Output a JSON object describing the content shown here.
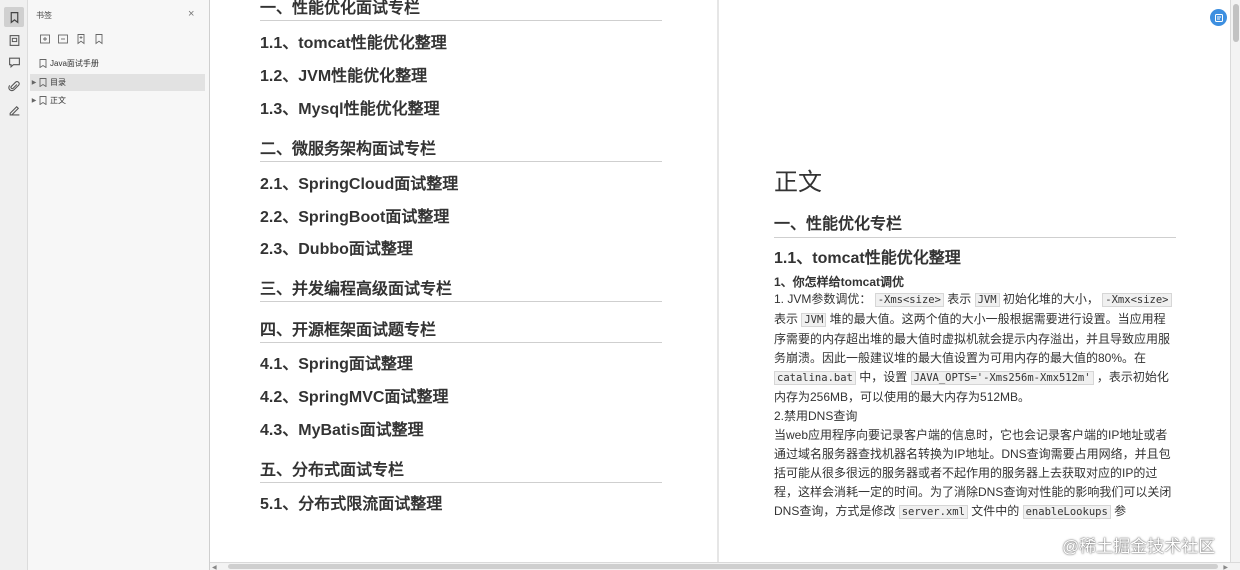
{
  "sidebar": {
    "title": "书签",
    "close_label": "×",
    "bookmarks": [
      {
        "label": "Java面试手册",
        "expandable": false
      },
      {
        "label": "目录",
        "expandable": true,
        "highlighted": true
      },
      {
        "label": "正文",
        "expandable": true
      }
    ]
  },
  "left_page": {
    "items": [
      {
        "level": 1,
        "text": "一、性能优化面试专栏"
      },
      {
        "level": 2,
        "text": "1.1、tomcat性能优化整理"
      },
      {
        "level": 2,
        "text": "1.2、JVM性能优化整理"
      },
      {
        "level": 2,
        "text": "1.3、Mysql性能优化整理"
      },
      {
        "level": 1,
        "text": "二、微服务架构面试专栏"
      },
      {
        "level": 2,
        "text": "2.1、SpringCloud面试整理"
      },
      {
        "level": 2,
        "text": "2.2、SpringBoot面试整理"
      },
      {
        "level": 2,
        "text": "2.3、Dubbo面试整理"
      },
      {
        "level": 1,
        "text": "三、并发编程高级面试专栏"
      },
      {
        "level": 1,
        "text": "四、开源框架面试题专栏"
      },
      {
        "level": 2,
        "text": "4.1、Spring面试整理"
      },
      {
        "level": 2,
        "text": "4.2、SpringMVC面试整理"
      },
      {
        "level": 2,
        "text": "4.3、MyBatis面试整理"
      },
      {
        "level": 1,
        "text": "五、分布式面试专栏"
      },
      {
        "level": 2,
        "text": "5.1、分布式限流面试整理"
      }
    ]
  },
  "right_page": {
    "title": "正文",
    "h1": "一、性能优化专栏",
    "h2": "1.1、tomcat性能优化整理",
    "h3": "1、你怎样给tomcat调优",
    "p1_a": "1. JVM参数调优：",
    "p1_code1": "-Xms<size>",
    "p1_b": "表示",
    "p1_code2": "JVM",
    "p1_c": "初始化堆的大小，",
    "p1_code3": "-Xmx<size>",
    "p1_d": "表示",
    "p1_code4": "JVM",
    "p1_e": "堆的最大值。这两个值的大小一般根据需要进行设置。当应用程序需要的内存超出堆的最大值时虚拟机就会提示内存溢出，并且导致应用服务崩溃。因此一般建议堆的最大值设置为可用内存的最大值的80%。在",
    "p1_code5": "catalina.bat",
    "p1_f": "中，设置",
    "p1_code6": "JAVA_OPTS='-Xms256m-Xmx512m'",
    "p1_g": "，表示初始化内存为256MB，可以使用的最大内存为512MB。",
    "p2_title": "2.禁用DNS查询",
    "p2_a": "当web应用程序向要记录客户端的信息时，它也会记录客户端的IP地址或者通过域名服务器查找机器名转换为IP地址。DNS查询需要占用网络，并且包括可能从很多很远的服务器或者不起作用的服务器上去获取对应的IP的过程，这样会消耗一定的时间。为了消除DNS查询对性能的影响我们可以关闭DNS查询，方式是修改",
    "p2_code1": "server.xml",
    "p2_b": "文件中的",
    "p2_code2": "enableLookups",
    "p2_c": "参"
  },
  "watermark": "@稀土掘金技术社区",
  "icons": [
    "bookmark-icon",
    "page-thumbnail-icon",
    "comment-icon",
    "attachment-icon",
    "signature-icon",
    "expand-icon",
    "collapse-icon",
    "add-bookmark-icon",
    "bookmark-options-icon",
    "translate-icon"
  ]
}
